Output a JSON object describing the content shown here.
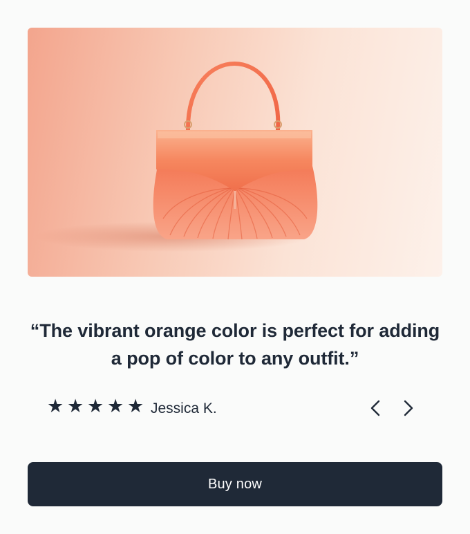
{
  "product": {
    "image_alt": "Orange ribbed handbag with handle",
    "colors": {
      "bag": "#f4724e",
      "bag_light": "#fb9a7c",
      "background_warm": "#f3a58d",
      "background_light": "#fdf1ea"
    }
  },
  "testimonial": {
    "quote": "“The vibrant orange color is perfect for adding a pop of color to any outfit.”",
    "rating": 5,
    "rating_max": 5,
    "star_glyph": "★",
    "reviewer": "Jessica K."
  },
  "navigation": {
    "prev_icon": "chevron-left-icon",
    "next_icon": "chevron-right-icon"
  },
  "cta": {
    "label": "Buy now",
    "color": "#1f2937"
  }
}
